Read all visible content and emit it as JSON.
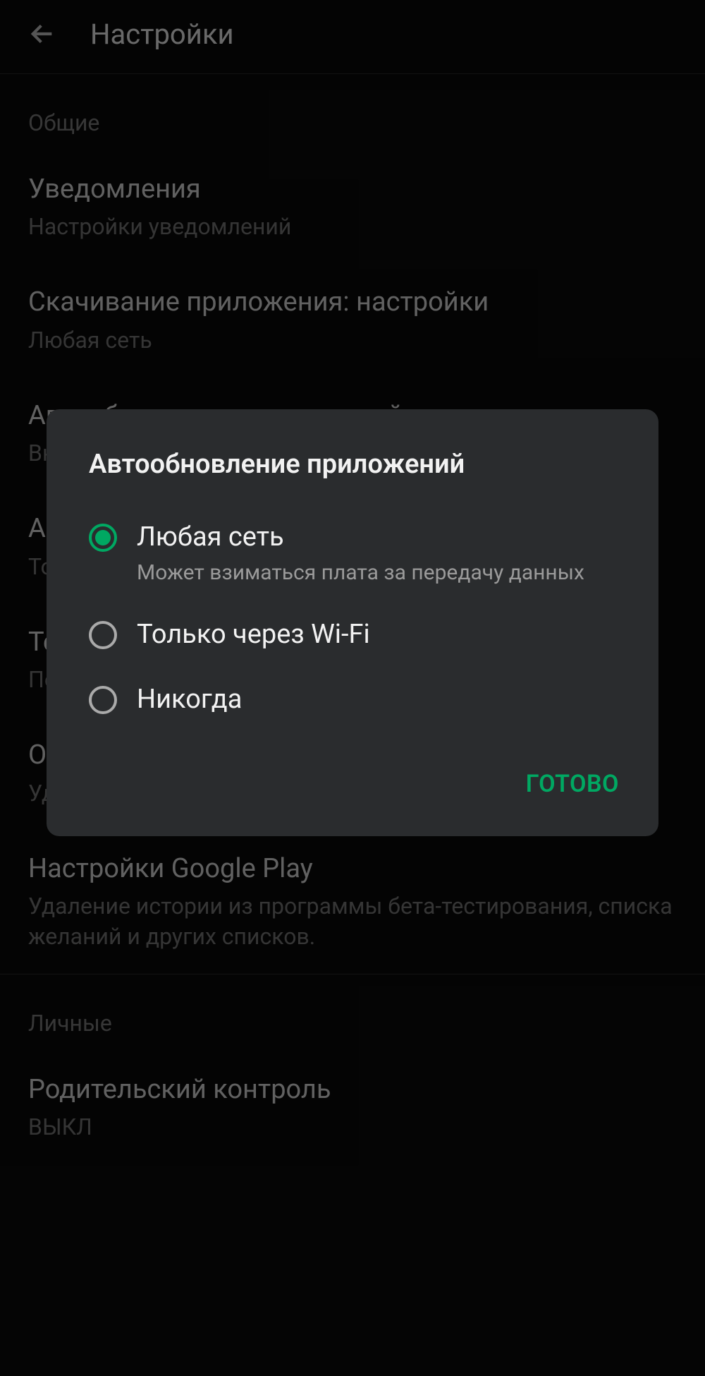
{
  "colors": {
    "accent": "#00a862"
  },
  "header": {
    "title": "Настройки"
  },
  "sections": {
    "general": {
      "label": "Общие",
      "items": [
        {
          "title": "Уведомления",
          "subtitle": "Настройки уведомлений"
        },
        {
          "title": "Скачивание приложения: настройки",
          "subtitle": "Любая сеть"
        },
        {
          "title": "Автообновление приложений",
          "subtitle": "Включено"
        },
        {
          "title": "Автозагрузка",
          "subtitle": "Только через Wi-Fi"
        },
        {
          "title": "Тема",
          "subtitle": "По умолчанию"
        },
        {
          "title": "Очистить историю поиска на устройстве",
          "subtitle": "Удаление истории поиска на этом устройстве"
        },
        {
          "title": "Настройки Google Play",
          "subtitle": "Удаление истории из программы бета-тестирования, списка желаний и других списков."
        }
      ]
    },
    "personal": {
      "label": "Личные",
      "items": [
        {
          "title": "Родительский контроль",
          "subtitle": "ВЫКЛ"
        }
      ]
    }
  },
  "dialog": {
    "title": "Автообновление приложений",
    "options": [
      {
        "label": "Любая сеть",
        "subtitle": "Может взиматься плата за передачу данных",
        "selected": true
      },
      {
        "label": "Только через Wi-Fi",
        "subtitle": "",
        "selected": false
      },
      {
        "label": "Никогда",
        "subtitle": "",
        "selected": false
      }
    ],
    "confirm": "ГОТОВО"
  }
}
